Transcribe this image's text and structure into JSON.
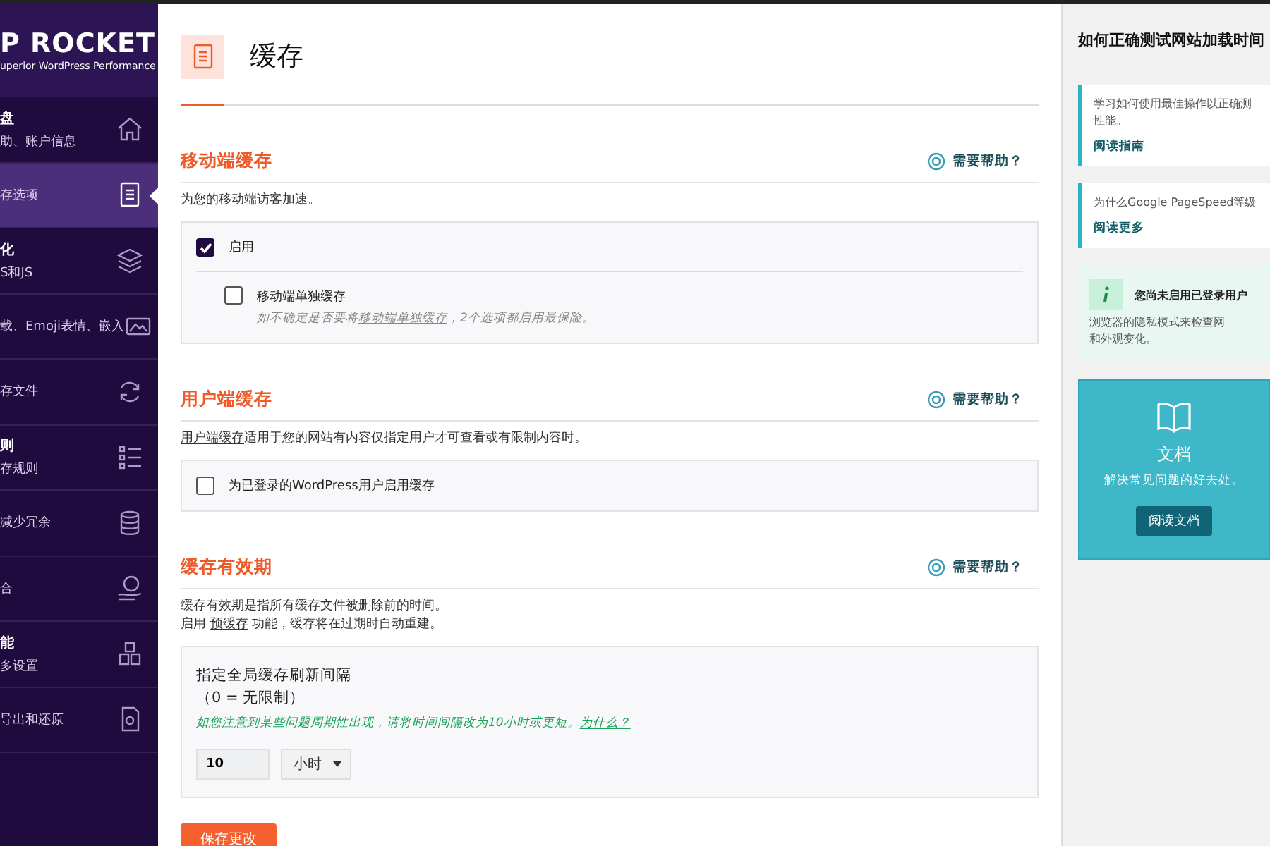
{
  "sidebar": {
    "logo": "P ROCKET",
    "tagline": "uperior WordPress Performance",
    "items": [
      {
        "title": "盘",
        "subtitle": "助、账户信息",
        "selected": false
      },
      {
        "subtitle": "存选项",
        "selected": true
      },
      {
        "title": "化",
        "subtitle": "S和JS",
        "selected": false
      },
      {
        "subtitle": "载、Emoji表情、嵌入",
        "selected": false
      },
      {
        "subtitle": "存文件",
        "selected": false
      },
      {
        "title": "则",
        "subtitle": "存规则",
        "selected": false
      },
      {
        "subtitle": "减少冗余",
        "selected": false
      },
      {
        "subtitle": "合",
        "selected": false
      },
      {
        "title": "能",
        "subtitle": "多设置",
        "selected": false
      },
      {
        "subtitle": "导出和还原",
        "selected": false
      }
    ]
  },
  "page": {
    "title": "缓存"
  },
  "sections": [
    {
      "title": "移动端缓存",
      "help": "需要帮助？",
      "description": [
        [
          {
            "kind": "plain",
            "text": "为您的移动端访客加速。"
          }
        ]
      ],
      "panel": [
        {
          "kind": "checkbox",
          "label": "启用",
          "checked": true
        },
        {
          "kind": "subcheckbox",
          "label": "移动端单独缓存",
          "checked": false,
          "note": [
            {
              "kind": "plain",
              "text": "如不确定是否要将"
            },
            {
              "kind": "link",
              "text": "移动端单独缓存"
            },
            {
              "kind": "plain",
              "text": "，2个选项都启用最保险。"
            }
          ]
        }
      ]
    },
    {
      "title": "用户端缓存",
      "help": "需要帮助？",
      "description": [
        [
          {
            "kind": "link",
            "text": "用户端缓存"
          },
          {
            "kind": "plain",
            "text": "适用于您的网站有内容仅指定用户才可查看或有限制内容时。"
          }
        ]
      ],
      "panel": [
        {
          "kind": "checkbox",
          "label": "为已登录的WordPress用户启用缓存",
          "checked": false
        }
      ]
    },
    {
      "title": "缓存有效期",
      "help": "需要帮助？",
      "description": [
        [
          {
            "kind": "plain",
            "text": "缓存有效期是指所有缓存文件被删除前的时间。"
          }
        ],
        [
          {
            "kind": "plain",
            "text": "启用 "
          },
          {
            "kind": "link",
            "text": "预缓存"
          },
          {
            "kind": "plain",
            "text": " 功能，缓存将在过期时自动重建。"
          }
        ]
      ],
      "panel": [
        {
          "kind": "interval",
          "label": "指定全局缓存刷新间隔",
          "sublabel": "（0 = 无限制）",
          "note": [
            {
              "kind": "plain",
              "text": "如您注意到某些问题周期性出现，请将时间间隔改为10小时或更短。"
            },
            {
              "kind": "link",
              "text": "为什么？"
            }
          ],
          "value": "10",
          "unit": "小时"
        }
      ]
    }
  ],
  "save_button": "保存更改",
  "aside": {
    "title": "如何正确测试网站加载时间",
    "cards": [
      {
        "kind": "link",
        "lines": [
          "学习如何使用最佳操作以正确测",
          "性能。"
        ],
        "link": "阅读指南"
      },
      {
        "kind": "link",
        "lines": [
          "为什么Google PageSpeed等级"
        ],
        "link": "阅读更多"
      },
      {
        "kind": "notice",
        "heading": "您尚未启用已登录用户",
        "lines": [
          "浏览器的隐私模式来检查网",
          "和外观变化。"
        ]
      },
      {
        "kind": "docs",
        "heading": "文档",
        "lines": [
          "解决常见问题的好去处。"
        ],
        "link": "阅读文档"
      }
    ]
  }
}
